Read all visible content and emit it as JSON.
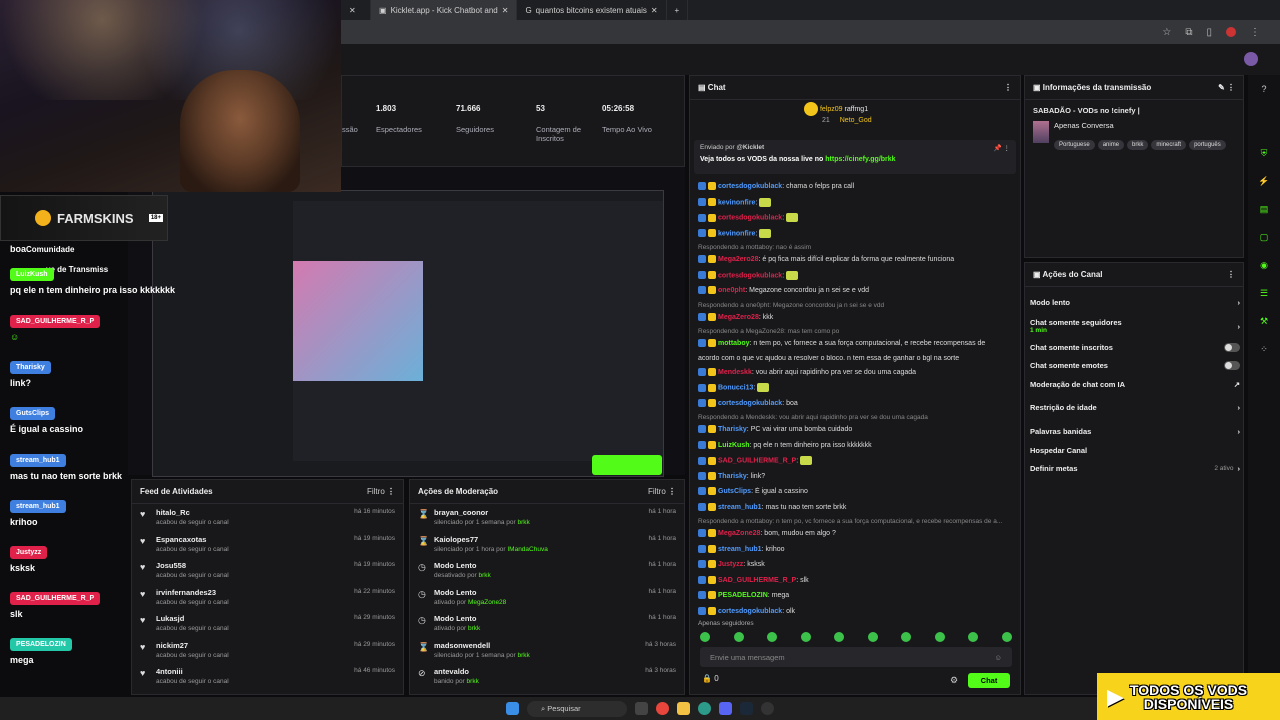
{
  "browser": {
    "tabs": [
      {
        "title": "Kicklet.app - Kick Chatbot and"
      },
      {
        "title": "quantos bitcoins existem atuais"
      }
    ],
    "new_tab": "+"
  },
  "overlay": {
    "sponsor": "FARMSKINS",
    "age": "18+",
    "messages": [
      {
        "user": "",
        "text": "boa",
        "color": "#2d2d2d"
      },
      {
        "user": "LuizKush",
        "text": "pq ele n tem dinheiro pra isso kkkkkkk",
        "color": "#53fc18"
      },
      {
        "user": "SAD_GUILHERME_R_P",
        "text": "",
        "color": "#e0214a"
      },
      {
        "user": "Tharisky",
        "text": "link?",
        "color": "#3f7fe0"
      },
      {
        "user": "GutsClips",
        "text": "É igual a cassino",
        "color": "#3f7fe0"
      },
      {
        "user": "stream_hub1",
        "text": "mas tu nao tem sorte brkk",
        "color": "#3f7fe0"
      },
      {
        "user": "stream_hub1",
        "text": "krihoo",
        "color": "#3f7fe0"
      },
      {
        "user": "Justyzz",
        "text": "ksksk",
        "color": "#e0214a"
      },
      {
        "user": "SAD_GUILHERME_R_P",
        "text": "slk",
        "color": "#e0214a"
      },
      {
        "user": "PESADELOZIN",
        "text": "mega",
        "color": "#22c8a8"
      }
    ],
    "side_labels": {
      "community": "Comunidade",
      "transmission": "ve de Transmiss"
    }
  },
  "stats": [
    {
      "value": "1.803",
      "label": "Espectadores"
    },
    {
      "value": "71.666",
      "label": "Seguidores"
    },
    {
      "value": "53",
      "label": "Contagem de Inscritos"
    },
    {
      "value": "05:26:58",
      "label": "Tempo Ao Vivo"
    }
  ],
  "stat_cut": "ssão",
  "activity": {
    "title": "Feed de Atividades",
    "filter": "Filtro",
    "rows": [
      {
        "name": "hitalo_Rc",
        "sub": "acabou de seguir o canal",
        "time": "há 16 minutos"
      },
      {
        "name": "Espancaxotas",
        "sub": "acabou de seguir o canal",
        "time": "há 19 minutos"
      },
      {
        "name": "Josu558",
        "sub": "acabou de seguir o canal",
        "time": "há 19 minutos"
      },
      {
        "name": "irvinfernandes23",
        "sub": "acabou de seguir o canal",
        "time": "há 22 minutos"
      },
      {
        "name": "Lukasjd",
        "sub": "acabou de seguir o canal",
        "time": "há 29 minutos"
      },
      {
        "name": "nickim27",
        "sub": "acabou de seguir o canal",
        "time": "há 29 minutos"
      },
      {
        "name": "4ntoniii",
        "sub": "acabou de seguir o canal",
        "time": "há 46 minutos"
      }
    ]
  },
  "moderation": {
    "title": "Ações de Moderação",
    "filter": "Filtro",
    "rows": [
      {
        "name": "brayan_coonor",
        "sub": "silenciado por 1 semana por",
        "by": "brkk",
        "time": "há 1 hora",
        "icon": "⌛"
      },
      {
        "name": "Kaiolopes77",
        "sub": "silenciado por 1 hora por",
        "by": "IMandaChuva",
        "time": "há 1 hora",
        "icon": "⌛"
      },
      {
        "name": "Modo Lento",
        "sub": "desativado por",
        "by": "brkk",
        "time": "há 1 hora",
        "icon": "◷"
      },
      {
        "name": "Modo Lento",
        "sub": "ativado por",
        "by": "MegaZone28",
        "time": "há 1 hora",
        "icon": "◷"
      },
      {
        "name": "Modo Lento",
        "sub": "ativado por",
        "by": "brkk",
        "time": "há 1 hora",
        "icon": "◷"
      },
      {
        "name": "madsonwendell",
        "sub": "silenciado por 1 semana por",
        "by": "brkk",
        "time": "há 3 horas",
        "icon": "⌛"
      },
      {
        "name": "antevaldo",
        "sub": "banido por",
        "by": "brkk",
        "time": "há 3 horas",
        "icon": "⊘"
      }
    ]
  },
  "chat": {
    "title": "Chat",
    "top": {
      "u1": "felpz09",
      "u2": "raffmg1",
      "u3": "Neto_God",
      "n": "21"
    },
    "pinned": {
      "by": "Enviado por",
      "bot": "@Kicklet",
      "text": "Veja todos os VODS da nossa live no",
      "link": "https://cinefy.gg/brkk"
    },
    "lines": [
      {
        "type": "msg",
        "user": "cortesdogokublack",
        "color": "#4f9bff",
        "text": "chama o felps pra call"
      },
      {
        "type": "msg",
        "user": "kevinonfire",
        "color": "#4f9bff",
        "text": ""
      },
      {
        "type": "msg",
        "user": "cortesdogokublack",
        "color": "#e0214a",
        "text": ""
      },
      {
        "type": "msg",
        "user": "kevinonfire",
        "color": "#4f9bff",
        "text": ""
      },
      {
        "type": "reply",
        "text": "Respondendo a mottaboy: nao é assim"
      },
      {
        "type": "msg",
        "user": "Mega2ero28",
        "color": "#e0214a",
        "text": "é pq fica mais difícil explicar da forma que realmente funciona"
      },
      {
        "type": "msg",
        "user": "cortesdogokublack",
        "color": "#e0214a",
        "text": ""
      },
      {
        "type": "msg",
        "user": "one0pht",
        "color": "#e0214a",
        "text": "Megazone concordou ja n sei se e vdd"
      },
      {
        "type": "reply",
        "text": "Respondendo a one0pht: Megazone concordou ja n sei se e vdd"
      },
      {
        "type": "msg",
        "user": "MegaZero28",
        "color": "#e0214a",
        "text": "kkk"
      },
      {
        "type": "reply",
        "text": "Respondendo a MegaZone28: mas tem como po"
      },
      {
        "type": "msg",
        "user": "mottaboy",
        "color": "#53fc18",
        "text": "n tem po, vc fornece a sua força computacional, e recebe recompensas de"
      },
      {
        "type": "cont",
        "text": "acordo com o que vc ajudou a resolver o bloco. n tem essa de ganhar o bgl na sorte"
      },
      {
        "type": "msg",
        "user": "Mendeskk",
        "color": "#e0214a",
        "text": "vou abrir aqui rapidinho pra ver se dou uma cagada"
      },
      {
        "type": "msg",
        "user": "Bonucci13",
        "color": "#4f9bff",
        "text": ""
      },
      {
        "type": "msg",
        "user": "cortesdogokublack",
        "color": "#4f9bff",
        "text": "boa"
      },
      {
        "type": "reply",
        "text": "Respondendo a Mendeskk: vou abrir aqui rapidinho pra ver se dou uma cagada"
      },
      {
        "type": "msg",
        "user": "Tharisky",
        "color": "#4f9bff",
        "text": "PC vai virar uma bomba cuidado"
      },
      {
        "type": "msg",
        "user": "LuizKush",
        "color": "#53fc18",
        "text": "pq ele n tem dinheiro pra isso kkkkkkk"
      },
      {
        "type": "msg",
        "user": "SAD_GUILHERME_R_P",
        "color": "#e0214a",
        "text": ""
      },
      {
        "type": "msg",
        "user": "Tharisky",
        "color": "#4f9bff",
        "text": "link?"
      },
      {
        "type": "msg",
        "user": "GutsClips",
        "color": "#4f9bff",
        "text": "É igual a cassino"
      },
      {
        "type": "msg",
        "user": "stream_hub1",
        "color": "#4f9bff",
        "text": "mas tu nao tem sorte brkk"
      },
      {
        "type": "reply",
        "text": "Respondendo a mottaboy: n tem po, vc fornece a sua força computacional, e recebe recompensas de a..."
      },
      {
        "type": "msg",
        "user": "MegaZone28",
        "color": "#e0214a",
        "text": "bom, mudou em algo ?"
      },
      {
        "type": "msg",
        "user": "stream_hub1",
        "color": "#4f9bff",
        "text": "krihoo"
      },
      {
        "type": "msg",
        "user": "Justyzz",
        "color": "#e0214a",
        "text": "ksksk"
      },
      {
        "type": "msg",
        "user": "SAD_GUILHERME_R_P",
        "color": "#e0214a",
        "text": "slk"
      },
      {
        "type": "msg",
        "user": "PESADELOZIN",
        "color": "#53fc18",
        "text": "mega"
      },
      {
        "type": "msg",
        "user": "cortesdogokublack",
        "color": "#4f9bff",
        "text": "olk"
      }
    ],
    "followers_only": "Apenas seguidores",
    "placeholder": "Envie uma mensagem",
    "count": "0",
    "send": "Chat"
  },
  "info": {
    "title": "Informações da transmissão",
    "stream_title": "SABADÃO - VODs no !cinefy |",
    "category": "Apenas Conversa",
    "tags": [
      "Portuguese",
      "anime",
      "brkk",
      "minecraft",
      "português"
    ]
  },
  "actions": {
    "title": "Ações do Canal",
    "items": [
      {
        "label": "Modo lento",
        "control": "chevron"
      },
      {
        "label": "Chat somente seguidores",
        "sub": "1 min",
        "control": "chevron"
      },
      {
        "label": "Chat somente inscritos",
        "control": "toggle"
      },
      {
        "label": "Chat somente emotes",
        "control": "toggle"
      },
      {
        "label": "Moderação de chat com IA",
        "control": "external"
      },
      {
        "label": "Restrição de idade",
        "control": "chevron"
      },
      {
        "label": "Palavras banidas",
        "control": "chevron"
      },
      {
        "label": "Hospedar Canal",
        "control": "none"
      },
      {
        "label": "Definir metas",
        "sub": "2 ativo",
        "control": "chevron"
      }
    ]
  },
  "taskbar": {
    "search": "Pesquisar"
  },
  "vod_banner": {
    "line1": "TODOS OS VODS",
    "line2": "DISPONÍVEIS"
  },
  "colors": {
    "kick_green": "#53fc18",
    "panel": "#18181b"
  }
}
